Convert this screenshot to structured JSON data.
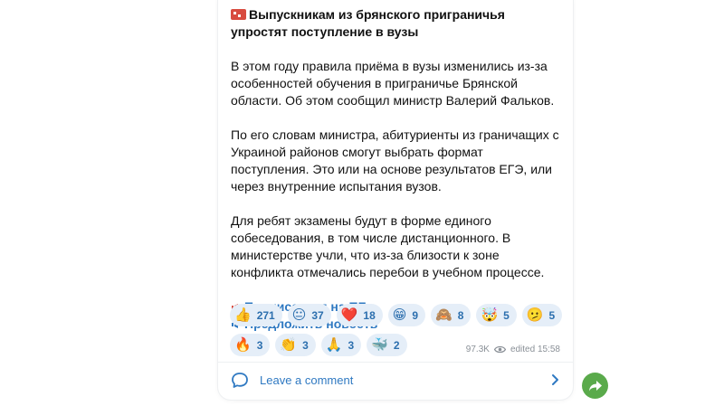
{
  "post": {
    "title": "Выпускникам из брянского приграничья упростят поступление в вузы",
    "paragraphs": [
      "В этом году правила приёма в вузы изменились из-за особенностей обучения в приграничье Брянской области. Об этом сообщил министр Валерий Фальков.",
      "По его словам министра, абитуриенты из граничащих с Украиной районов смогут выбрать формат поступления. Это или на основе результатов ЕГЭ, или через внутренние испытания вузов.",
      "Для ребят экзамены будут в форме единого собеседования, в том числе дистанционного. В министерстве учли, что из-за близости к зоне конфликта отмечались перебои в учебном процессе."
    ],
    "links": [
      "Подписаться на ПБ",
      "Предложить новость"
    ]
  },
  "reactions": {
    "row1": [
      {
        "emoji": "👍",
        "count": "271"
      },
      {
        "emoji": "😐",
        "count": "37"
      },
      {
        "emoji": "❤️",
        "count": "18"
      },
      {
        "emoji": "😁",
        "count": "9"
      },
      {
        "emoji": "🙈",
        "count": "8"
      },
      {
        "emoji": "🤯",
        "count": "5"
      },
      {
        "emoji": "🫤",
        "count": "5"
      }
    ],
    "row2": [
      {
        "emoji": "🔥",
        "count": "3"
      },
      {
        "emoji": "👏",
        "count": "3"
      },
      {
        "emoji": "🙏",
        "count": "3"
      },
      {
        "emoji": "🐳",
        "count": "2"
      }
    ]
  },
  "meta": {
    "views": "97.3K",
    "edited": "edited 15:58"
  },
  "comment": {
    "label": "Leave a comment"
  },
  "colors": {
    "accent": "#2f79c2",
    "chip_bg": "#e5eef8",
    "share": "#5aaa4b"
  },
  "icons": {
    "comment": "comment-bubble-icon",
    "chevron": "chevron-right-icon",
    "share": "share-arrow-icon",
    "views": "eye-icon"
  }
}
